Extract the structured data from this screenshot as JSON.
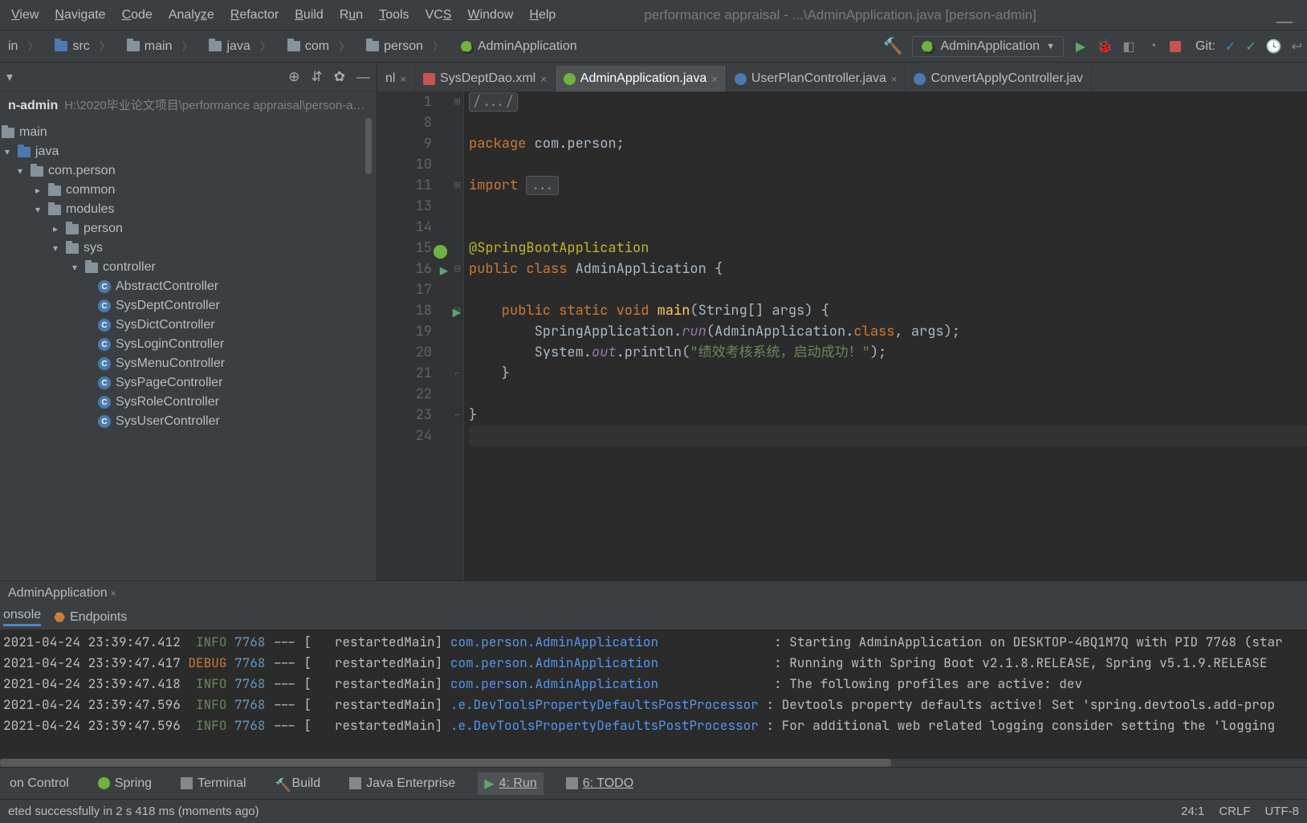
{
  "window": {
    "title": "performance appraisal - ...\\AdminApplication.java [person-admin]"
  },
  "menu": {
    "view": "View",
    "navigate": "Navigate",
    "code": "Code",
    "analyze": "Analyze",
    "refactor": "Refactor",
    "build": "Build",
    "run": "Run",
    "tools": "Tools",
    "vcs": "VCS",
    "window": "Window",
    "help": "Help"
  },
  "breadcrumbs": {
    "items": [
      "in",
      "src",
      "main",
      "java",
      "com",
      "person",
      "AdminApplication"
    ]
  },
  "run_config": {
    "name": "AdminApplication",
    "git_label": "Git:"
  },
  "sidebar": {
    "root_name": "n-admin",
    "root_path": "H:\\2020毕业论文项目\\performance appraisal\\person-a…",
    "nodes": {
      "main": "main",
      "java": "java",
      "pkg": "com.person",
      "common": "common",
      "modules": "modules",
      "person": "person",
      "sys": "sys",
      "controller": "controller",
      "classes": [
        "AbstractController",
        "SysDeptController",
        "SysDictController",
        "SysLoginController",
        "SysMenuController",
        "SysPageController",
        "SysRoleController",
        "SysUserController"
      ]
    }
  },
  "tabs": {
    "t0": "nl",
    "t1": "SysDeptDao.xml",
    "t2": "AdminApplication.java",
    "t3": "UserPlanController.java",
    "t4": "ConvertApplyController.jav"
  },
  "code": {
    "line_numbers": [
      "1",
      "8",
      "9",
      "10",
      "11",
      "13",
      "14",
      "15",
      "16",
      "17",
      "18",
      "19",
      "20",
      "21",
      "22",
      "23",
      "24"
    ],
    "l1": "/.../",
    "l9a": "package ",
    "l9b": "com.person;",
    "l11a": "import ",
    "l11b": "...",
    "l15": "@SpringBootApplication",
    "l16a": "public ",
    "l16b": "class ",
    "l16c": "AdminApplication {",
    "l18a": "    public ",
    "l18b": "static ",
    "l18c": "void ",
    "l18d": "main",
    "l18e": "(String[] args) {",
    "l19a": "        SpringApplication.",
    "l19b": "run",
    "l19c": "(AdminApplication.",
    "l19d": "class",
    "l19e": ", args);",
    "l20a": "        System.",
    "l20b": "out",
    "l20c": ".println(",
    "l20d": "\"绩效考核系统，启动成功！\"",
    "l20e": ");",
    "l21": "    }",
    "l23": "}"
  },
  "run_panel": {
    "tab": "AdminApplication",
    "console_tab": "onsole",
    "endpoints_tab": "Endpoints"
  },
  "console": {
    "rows": [
      {
        "ts": "2021-04-24 23:39:47.412",
        "lvl": "INFO",
        "pid": "7768",
        "thread": "restartedMain",
        "logger": "com.person.AdminApplication",
        "msg": "Starting AdminApplication on DESKTOP-4BQ1M7Q with PID 7768 (star"
      },
      {
        "ts": "2021-04-24 23:39:47.417",
        "lvl": "DEBUG",
        "pid": "7768",
        "thread": "restartedMain",
        "logger": "com.person.AdminApplication",
        "msg": "Running with Spring Boot v2.1.8.RELEASE, Spring v5.1.9.RELEASE"
      },
      {
        "ts": "2021-04-24 23:39:47.418",
        "lvl": "INFO",
        "pid": "7768",
        "thread": "restartedMain",
        "logger": "com.person.AdminApplication",
        "msg": "The following profiles are active: dev"
      },
      {
        "ts": "2021-04-24 23:39:47.596",
        "lvl": "INFO",
        "pid": "7768",
        "thread": "restartedMain",
        "logger": ".e.DevToolsPropertyDefaultsPostProcessor",
        "msg": "Devtools property defaults active! Set 'spring.devtools.add-prop"
      },
      {
        "ts": "2021-04-24 23:39:47.596",
        "lvl": "INFO",
        "pid": "7768",
        "thread": "restartedMain",
        "logger": ".e.DevToolsPropertyDefaultsPostProcessor",
        "msg": "For additional web related logging consider setting the 'logging"
      }
    ]
  },
  "bottom_tabs": {
    "version_control": "on Control",
    "spring": "Spring",
    "terminal": "Terminal",
    "build": "Build",
    "java_enterprise": "Java Enterprise",
    "run": "4: Run",
    "todo": "6: TODO"
  },
  "status": {
    "left": "eted successfully in 2 s 418 ms (moments ago)",
    "pos": "24:1",
    "eol": "CRLF",
    "enc": "UTF-8"
  }
}
